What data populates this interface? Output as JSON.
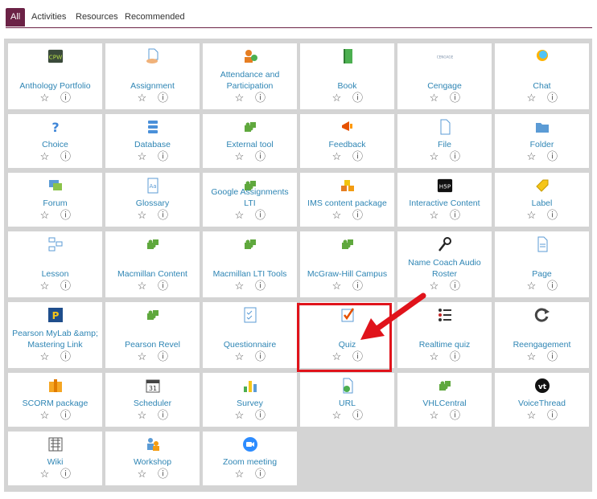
{
  "tabs": [
    {
      "label": "All",
      "active": true
    },
    {
      "label": "Activities",
      "active": false
    },
    {
      "label": "Resources",
      "active": false
    },
    {
      "label": "Recommended",
      "active": false
    }
  ],
  "tiles": [
    {
      "name": "Anthology Portfolio",
      "icon": "anthology-portfolio-icon"
    },
    {
      "name": "Assignment",
      "icon": "assignment-icon"
    },
    {
      "name": "Attendance and Participation",
      "icon": "attendance-icon"
    },
    {
      "name": "Book",
      "icon": "book-icon"
    },
    {
      "name": "Cengage",
      "icon": "cengage-icon"
    },
    {
      "name": "Chat",
      "icon": "chat-icon"
    },
    {
      "name": "Choice",
      "icon": "choice-icon"
    },
    {
      "name": "Database",
      "icon": "database-icon"
    },
    {
      "name": "External tool",
      "icon": "external-tool-icon"
    },
    {
      "name": "Feedback",
      "icon": "feedback-icon"
    },
    {
      "name": "File",
      "icon": "file-icon"
    },
    {
      "name": "Folder",
      "icon": "folder-icon"
    },
    {
      "name": "Forum",
      "icon": "forum-icon"
    },
    {
      "name": "Glossary",
      "icon": "glossary-icon"
    },
    {
      "name": "Google Assignments LTI",
      "icon": "puzzle-icon"
    },
    {
      "name": "IMS content package",
      "icon": "ims-package-icon"
    },
    {
      "name": "Interactive Content",
      "icon": "h5p-icon"
    },
    {
      "name": "Label",
      "icon": "label-icon"
    },
    {
      "name": "Lesson",
      "icon": "lesson-icon"
    },
    {
      "name": "Macmillan Content",
      "icon": "puzzle-icon"
    },
    {
      "name": "Macmillan LTI Tools",
      "icon": "puzzle-icon"
    },
    {
      "name": "McGraw-Hill Campus",
      "icon": "puzzle-icon"
    },
    {
      "name": "Name Coach Audio Roster",
      "icon": "microphone-icon"
    },
    {
      "name": "Page",
      "icon": "page-icon"
    },
    {
      "name": "Pearson MyLab &amp; Mastering Link",
      "icon": "pearson-icon"
    },
    {
      "name": "Pearson Revel",
      "icon": "puzzle-icon"
    },
    {
      "name": "Questionnaire",
      "icon": "questionnaire-icon"
    },
    {
      "name": "Quiz",
      "icon": "quiz-icon"
    },
    {
      "name": "Realtime quiz",
      "icon": "realtime-quiz-icon"
    },
    {
      "name": "Reengagement",
      "icon": "reengagement-icon"
    },
    {
      "name": "SCORM package",
      "icon": "scorm-icon"
    },
    {
      "name": "Scheduler",
      "icon": "calendar-icon"
    },
    {
      "name": "Survey",
      "icon": "survey-icon"
    },
    {
      "name": "URL",
      "icon": "url-icon"
    },
    {
      "name": "VHLCentral",
      "icon": "puzzle-icon"
    },
    {
      "name": "VoiceThread",
      "icon": "voicethread-icon"
    },
    {
      "name": "Wiki",
      "icon": "wiki-icon"
    },
    {
      "name": "Workshop",
      "icon": "workshop-icon"
    },
    {
      "name": "Zoom meeting",
      "icon": "zoom-icon"
    }
  ],
  "icon_labels": {
    "anthology": "CPW",
    "cengage": "CENGAGE",
    "h5p": "H5P",
    "scheduler_day": "31",
    "voicethread": "vt"
  },
  "actions": {
    "star": "☆",
    "info": "ⓘ"
  },
  "colors": {
    "accent": "#6b2246",
    "link": "#2e85b4",
    "highlight": "#e0131b",
    "puzzle": "#5fa83d"
  }
}
